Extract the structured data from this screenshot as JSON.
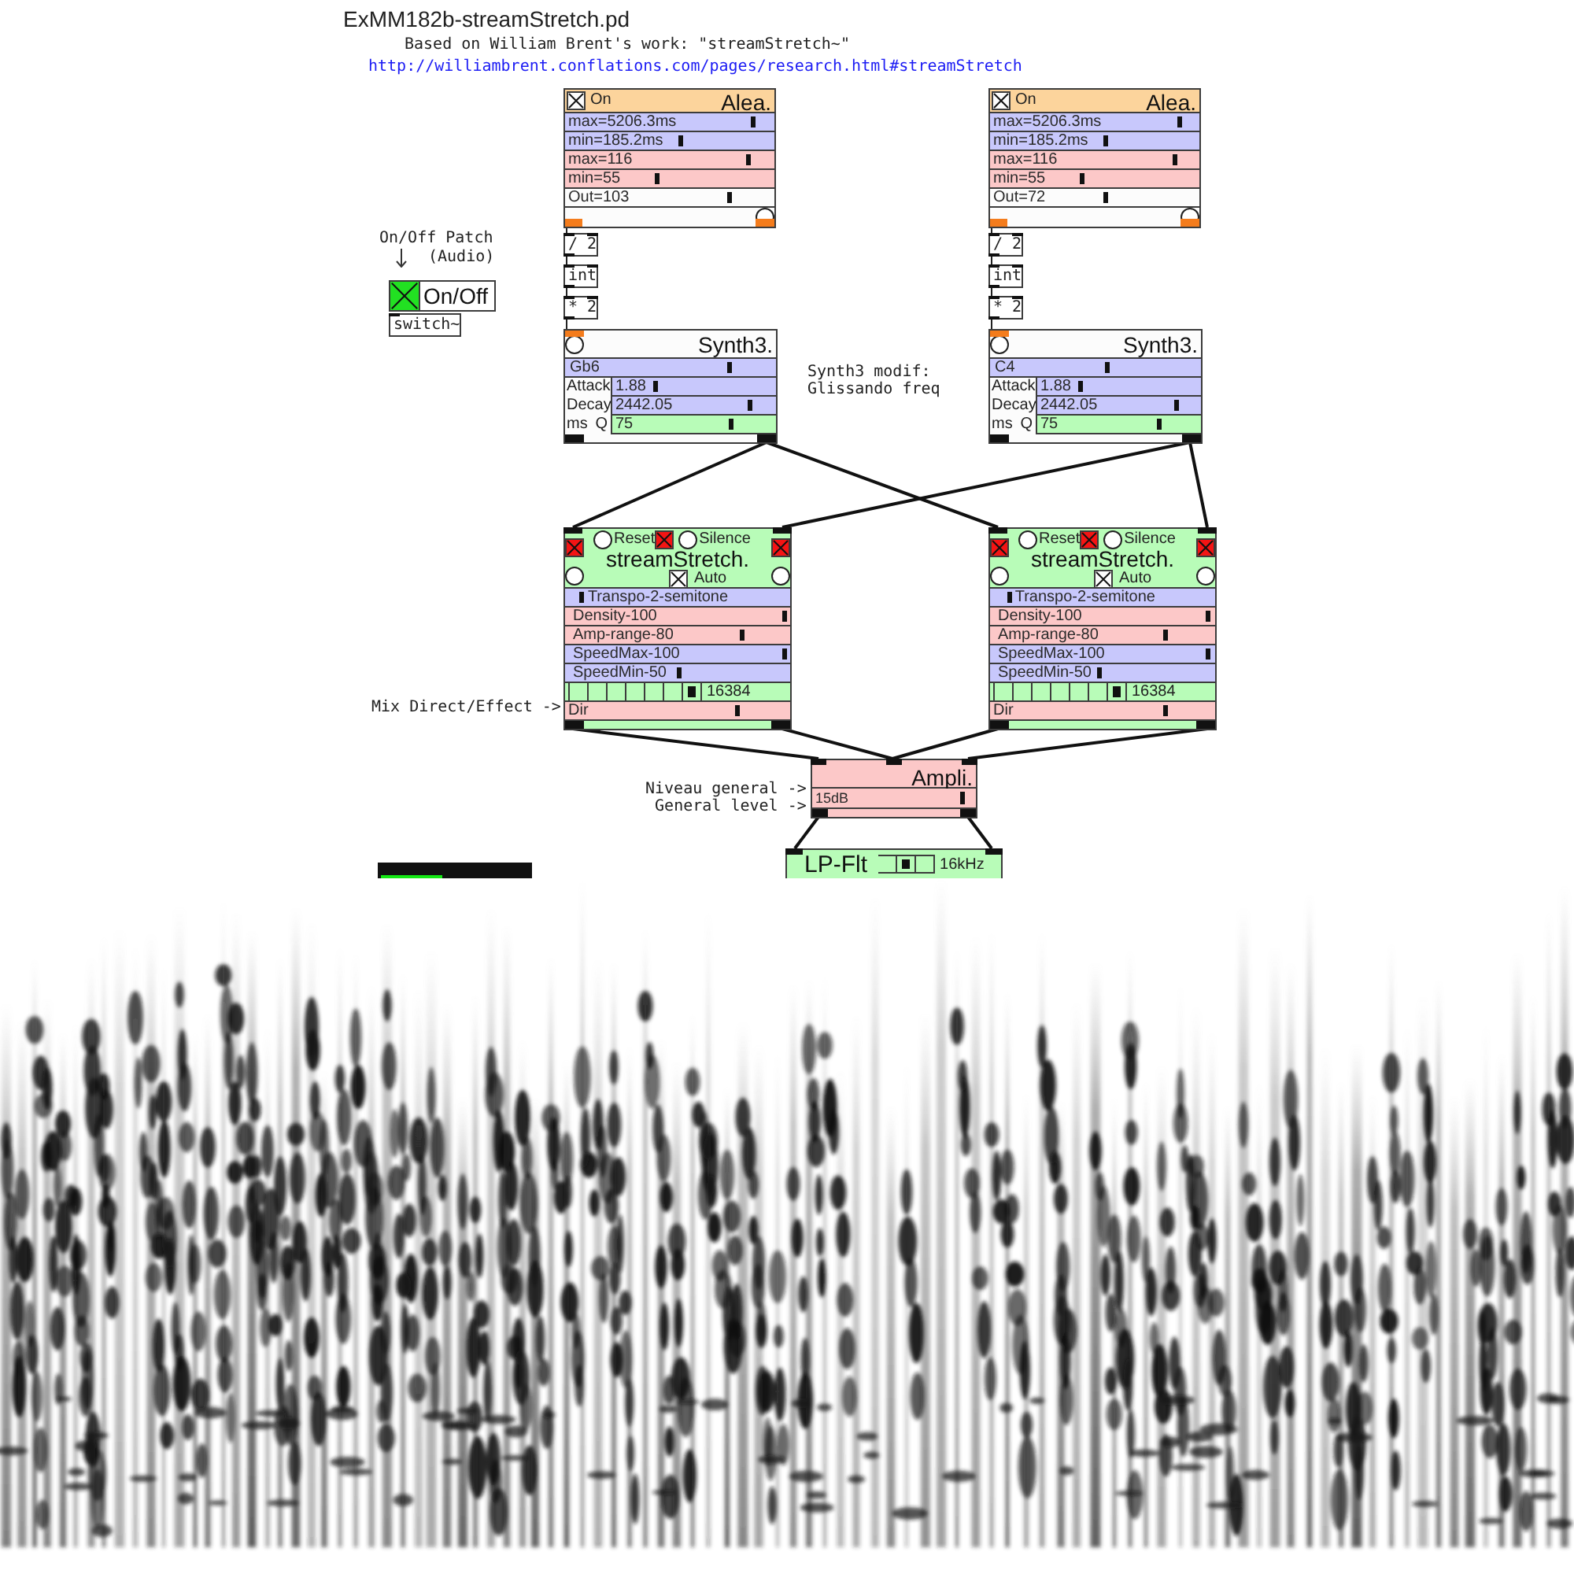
{
  "patch": {
    "title": "ExMM182b-streamStretch.pd",
    "credit": "Based on William Brent's work: \"streamStretch~\"",
    "link": "http://williambrent.conflations.com/pages/research.html#streamStretch"
  },
  "power": {
    "caption": "On/Off Patch",
    "hint": "(Audio)",
    "toggle": {
      "label": "On/Off",
      "checked": true
    },
    "object": "switch~"
  },
  "synth_note": "Synth3 modif:\nGlissando freq",
  "mix_note": "Mix Direct/Effect ->",
  "voices": [
    {
      "alea": {
        "title": "Alea.",
        "toggle": {
          "label": "On",
          "checked": true
        },
        "sliders": [
          {
            "label": "max=5206.3ms",
            "color": "#c8c8fc",
            "level": 0.9
          },
          {
            "label": "min=185.2ms",
            "color": "#c8c8fc",
            "level": 0.56
          },
          {
            "label": "max=116",
            "color": "#fcc8c8",
            "level": 0.88
          },
          {
            "label": "min=55",
            "color": "#fcc8c8",
            "level": 0.44
          },
          {
            "label": "Out=103",
            "color": "#fcfcfc",
            "level": 0.79
          }
        ]
      },
      "objects": [
        "/ 2",
        "int",
        "* 2"
      ],
      "synth": {
        "title": "Synth3.",
        "note": {
          "label": "Gb6",
          "level": 0.78
        },
        "params": [
          {
            "name": "Attack",
            "value": "1.88",
            "color": "#c8c8fc",
            "level": 0.27
          },
          {
            "name": "Decay",
            "value": "2442.05",
            "color": "#c8c8fc",
            "level": 0.85
          },
          {
            "name": "Q",
            "value": "75",
            "color": "#b8fcb8",
            "level": 0.73
          }
        ],
        "unit": "ms"
      },
      "stretch": {
        "title": "streamStretch.",
        "side_toggles": [
          {
            "checked": true
          },
          {
            "checked": true
          }
        ],
        "reset": "Reset",
        "silence_toggle": {
          "checked": true
        },
        "silence": "Silence",
        "auto": {
          "label": "Auto",
          "checked": true
        },
        "sliders": [
          {
            "label": "Transpo-2-semitone",
            "color": "#c8c8fc",
            "level": 0.08
          },
          {
            "label": "Density-100",
            "color": "#fcc8c8",
            "level": 0.98
          },
          {
            "label": "Amp-range-80",
            "color": "#fcc8c8",
            "level": 0.79
          },
          {
            "label": "SpeedMax-100",
            "color": "#c8c8fc",
            "level": 0.98
          },
          {
            "label": "SpeedMin-50",
            "color": "#c8c8fc",
            "level": 0.51
          }
        ],
        "window": {
          "options": [
            {
              "selected": false
            },
            {
              "selected": false
            },
            {
              "selected": false
            },
            {
              "selected": false
            },
            {
              "selected": false
            },
            {
              "selected": false
            },
            {
              "selected": true
            }
          ],
          "value": "16384"
        },
        "mix": {
          "label": "Dir",
          "level": 0.77
        }
      }
    },
    {
      "alea": {
        "title": "Alea.",
        "toggle": {
          "label": "On",
          "checked": true
        },
        "sliders": [
          {
            "label": "max=5206.3ms",
            "color": "#c8c8fc",
            "level": 0.91
          },
          {
            "label": "min=185.2ms",
            "color": "#c8c8fc",
            "level": 0.56
          },
          {
            "label": "max=116",
            "color": "#fcc8c8",
            "level": 0.89
          },
          {
            "label": "min=55",
            "color": "#fcc8c8",
            "level": 0.44
          },
          {
            "label": "Out=72",
            "color": "#fcfcfc",
            "level": 0.56
          }
        ]
      },
      "objects": [
        "/ 2",
        "int",
        "* 2"
      ],
      "synth": {
        "title": "Synth3.",
        "note": {
          "label": "C4",
          "level": 0.56
        },
        "params": [
          {
            "name": "Attack",
            "value": "1.88",
            "color": "#c8c8fc",
            "level": 0.27
          },
          {
            "name": "Decay",
            "value": "2442.05",
            "color": "#c8c8fc",
            "level": 0.86
          },
          {
            "name": "Q",
            "value": "75",
            "color": "#b8fcb8",
            "level": 0.75
          }
        ],
        "unit": "ms"
      },
      "stretch": {
        "title": "streamStretch.",
        "side_toggles": [
          {
            "checked": true
          },
          {
            "checked": true
          }
        ],
        "reset": "Reset",
        "silence_toggle": {
          "checked": true
        },
        "silence": "Silence",
        "auto": {
          "label": "Auto",
          "checked": true
        },
        "sliders": [
          {
            "label": "Transpo-2-semitone",
            "color": "#c8c8fc",
            "level": 0.09
          },
          {
            "label": "Density-100",
            "color": "#fcc8c8",
            "level": 0.97
          },
          {
            "label": "Amp-range-80",
            "color": "#fcc8c8",
            "level": 0.78
          },
          {
            "label": "SpeedMax-100",
            "color": "#c8c8fc",
            "level": 0.97
          },
          {
            "label": "SpeedMin-50",
            "color": "#c8c8fc",
            "level": 0.49
          }
        ],
        "window": {
          "options": [
            {
              "selected": false
            },
            {
              "selected": false
            },
            {
              "selected": false
            },
            {
              "selected": false
            },
            {
              "selected": false
            },
            {
              "selected": false
            },
            {
              "selected": true
            }
          ],
          "value": "16384"
        },
        "mix": {
          "label": "Dir",
          "level": 0.78
        }
      }
    }
  ],
  "amp": {
    "title": "Ampli.",
    "note": "Niveau general ->\nGeneral level ->",
    "slider": {
      "label": "15dB",
      "level": 0.92
    }
  },
  "filter": {
    "title": "LP-Flt",
    "options": [
      {
        "selected": false
      },
      {
        "selected": true
      },
      {
        "selected": false
      }
    ],
    "value": "16kHz"
  },
  "meter": {
    "level": 0.42
  }
}
